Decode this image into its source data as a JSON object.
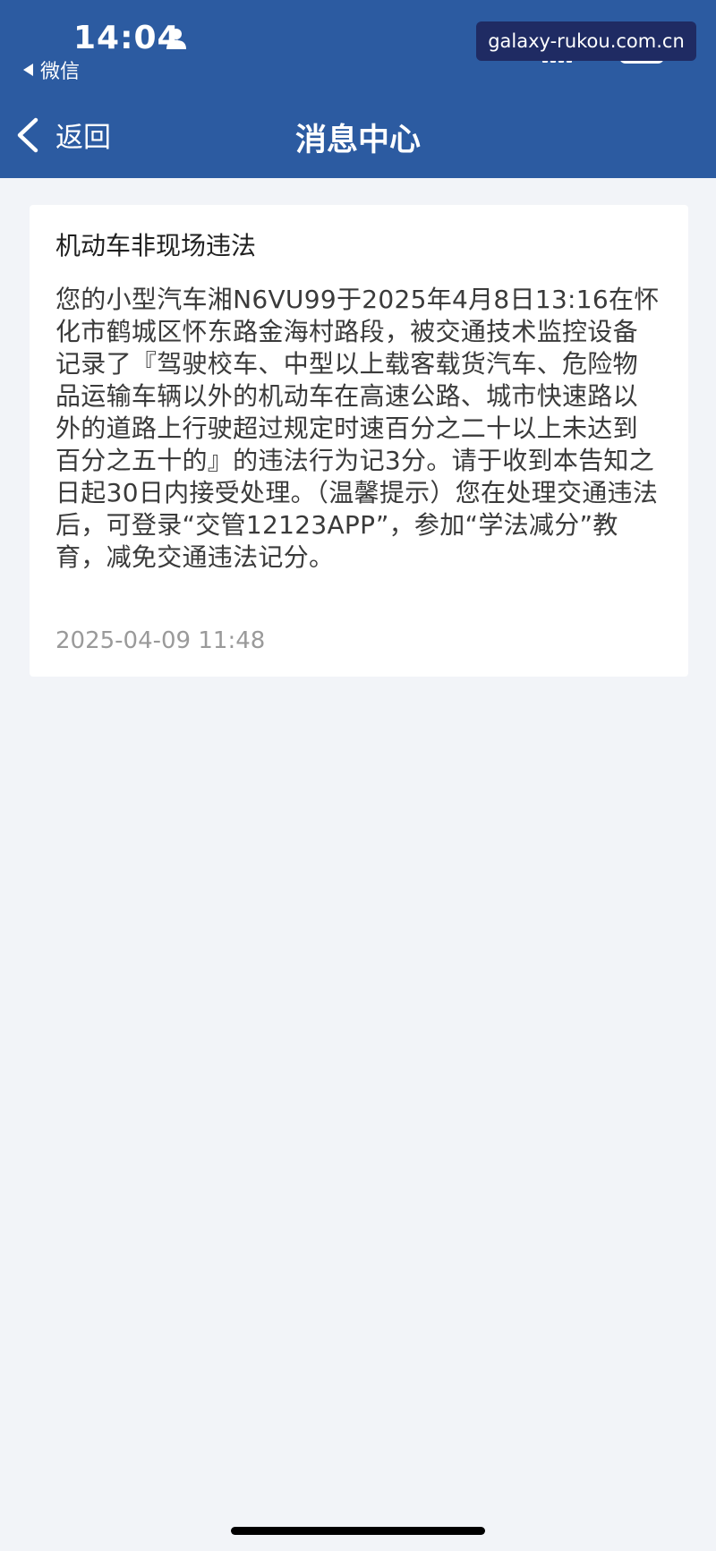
{
  "status_bar": {
    "time": "14:04",
    "back_app_label": "微信",
    "network": "5G",
    "battery": "73"
  },
  "watermark": "galaxy-rukou.com.cn",
  "nav": {
    "back_label": "返回",
    "title": "消息中心"
  },
  "message": {
    "title": "机动车非现场违法",
    "body": "您的小型汽车湘N6VU99于2025年4月8日13:16在怀化市鹤城区怀东路金海村路段，被交通技术监控设备记录了『驾驶校车、中型以上载客载货汽车、危险物品运输车辆以外的机动车在高速公路、城市快速路以外的道路上行驶超过规定时速百分之二十以上未达到百分之五十的』的违法行为记3分。请于收到本告知之日起30日内接受处理。（温馨提示）您在处理交通违法后，可登录“交管12123APP”，参加“学法减分”教育，减免交通违法记分。",
    "timestamp": "2025-04-09 11:48"
  },
  "colors": {
    "header_bg": "#2c5ba1",
    "page_bg": "#f2f4f8",
    "card_bg": "#ffffff",
    "timestamp": "#9a9a9a"
  }
}
